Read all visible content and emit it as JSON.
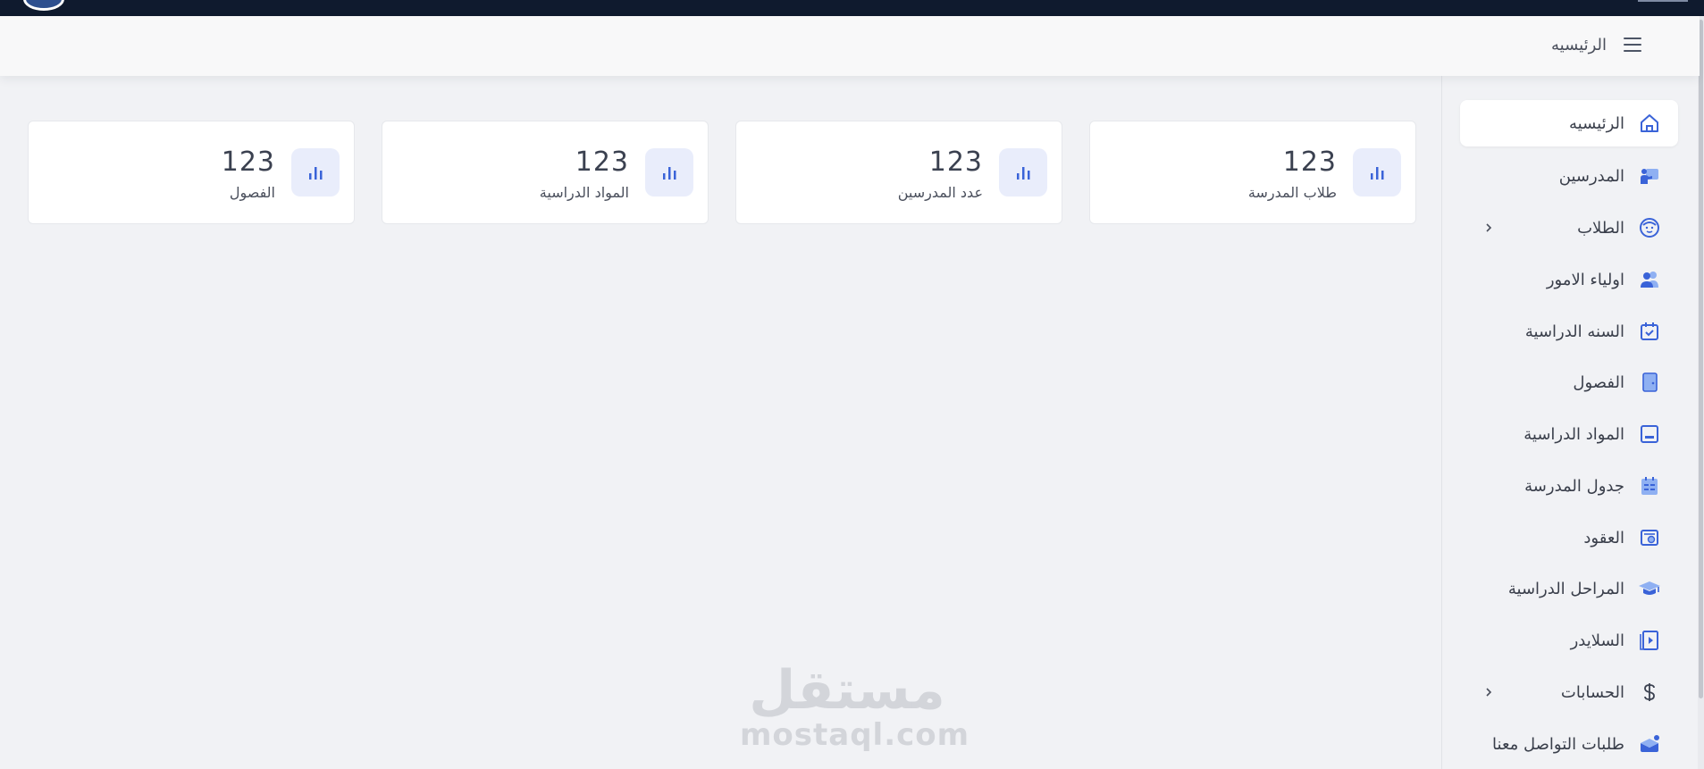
{
  "header": {
    "breadcrumb": "الرئيسيه"
  },
  "sidebar": {
    "items": [
      {
        "label": "الرئيسيه",
        "icon": "home-icon",
        "active": true
      },
      {
        "label": "المدرسين",
        "icon": "teacher-icon"
      },
      {
        "label": "الطلاب",
        "icon": "student-face-icon",
        "has_submenu": true
      },
      {
        "label": "اولياء الامور",
        "icon": "parents-icon"
      },
      {
        "label": "السنه الدراسية",
        "icon": "calendar-check-icon"
      },
      {
        "label": "الفصول",
        "icon": "classroom-door-icon"
      },
      {
        "label": "المواد الدراسية",
        "icon": "subjects-icon"
      },
      {
        "label": "جدول المدرسة",
        "icon": "schedule-icon"
      },
      {
        "label": "العقود",
        "icon": "contract-icon"
      },
      {
        "label": "المراحل الدراسية",
        "icon": "graduation-cap-icon"
      },
      {
        "label": "السلايدر",
        "icon": "slider-icon"
      },
      {
        "label": "الحسابات",
        "icon": "dollar-icon",
        "has_submenu": true
      },
      {
        "label": "طلبات التواصل معنا",
        "icon": "inbox-icon"
      }
    ]
  },
  "stats": [
    {
      "value": "123",
      "label": "طلاب المدرسة",
      "icon": "bar-chart-icon"
    },
    {
      "value": "123",
      "label": "عدد المدرسين",
      "icon": "bar-chart-icon"
    },
    {
      "value": "123",
      "label": "المواد الدراسية",
      "icon": "bar-chart-icon"
    },
    {
      "value": "123",
      "label": "الفصول",
      "icon": "bar-chart-icon"
    }
  ],
  "watermark": {
    "arabic": "مستقل",
    "latin": "mostaql.com"
  },
  "colors": {
    "accent": "#3a63d8",
    "icon_light": "#8fb0f2",
    "topbar": "#0f1a2e",
    "background": "#f1f2f5"
  }
}
